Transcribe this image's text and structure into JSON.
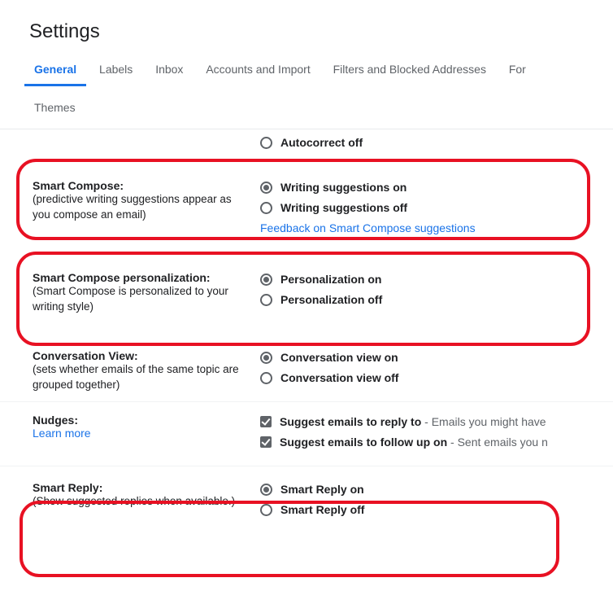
{
  "title": "Settings",
  "tabs": {
    "general": "General",
    "labels": "Labels",
    "inbox": "Inbox",
    "accounts": "Accounts and Import",
    "filters": "Filters and Blocked Addresses",
    "forwarding": "For",
    "themes": "Themes"
  },
  "autocorrect": {
    "off": "Autocorrect off"
  },
  "smart_compose": {
    "title": "Smart Compose:",
    "sub": "(predictive writing suggestions appear as you compose an email)",
    "on": "Writing suggestions on",
    "off": "Writing suggestions off",
    "feedback": "Feedback on Smart Compose suggestions"
  },
  "personalization": {
    "title": "Smart Compose personalization:",
    "sub": "(Smart Compose is personalized to your writing style)",
    "on": "Personalization on",
    "off": "Personalization off"
  },
  "conversation": {
    "title": "Conversation View:",
    "sub": "(sets whether emails of the same topic are grouped together)",
    "on": "Conversation view on",
    "off": "Conversation view off"
  },
  "nudges": {
    "title": "Nudges:",
    "learn": "Learn more",
    "reply_bold": "Suggest emails to reply to",
    "reply_rest": " - Emails you might have",
    "follow_bold": "Suggest emails to follow up on",
    "follow_rest": " - Sent emails you n"
  },
  "smart_reply": {
    "title": "Smart Reply:",
    "sub": "(Show suggested replies when available.)",
    "on": "Smart Reply on",
    "off": "Smart Reply off"
  }
}
